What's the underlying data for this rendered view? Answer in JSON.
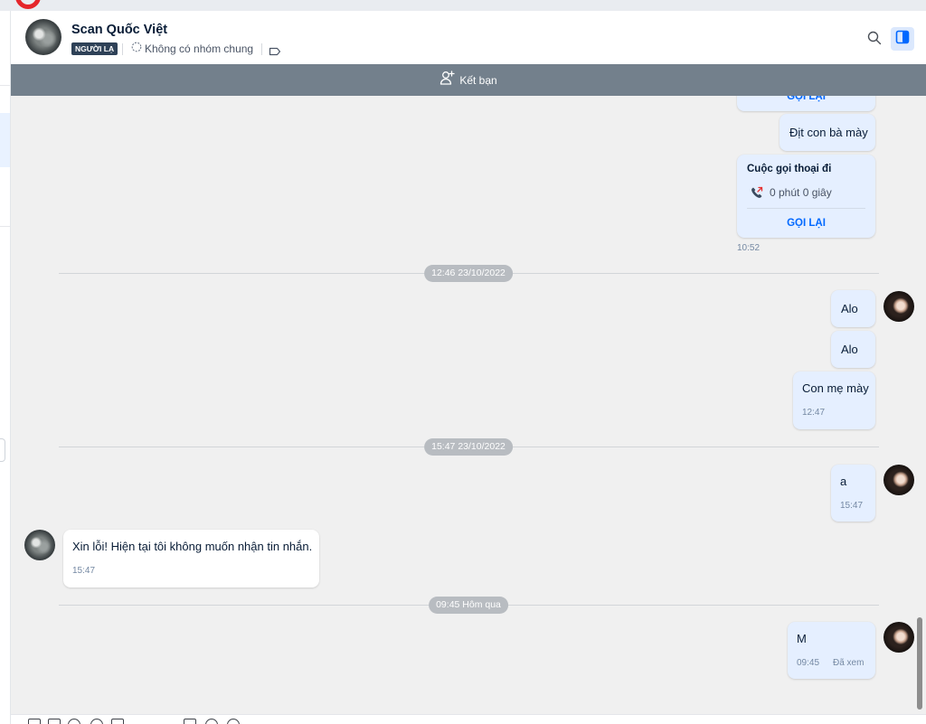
{
  "colors": {
    "accent": "#0068ff",
    "outgoing_bubble": "#e5efff",
    "incoming_bubble": "#ffffff",
    "friend_bar": "#73808c",
    "chat_background": "#f0f0f0",
    "stranger_badge": "#2e4157",
    "separator_pill": "#b8bcc1",
    "missed_call_arrow": "#e5302f",
    "brand_red": "#e5262b"
  },
  "icons": {
    "group": "group-dashed-circle-icon",
    "tag": "tag-icon",
    "search": "search-icon",
    "panel_toggle": "panel-toggle-icon",
    "add_friend": "add-user-icon",
    "outgoing_call": "outgoing-call-icon"
  },
  "header": {
    "contact_name": "Scan Quốc Việt",
    "stranger_badge": "NGƯỜI LẠ",
    "common_groups": "Không có nhóm chung"
  },
  "friend_bar": {
    "add_friend_label": "Kết bạn"
  },
  "conversation": {
    "partial_call": {
      "callback_label": "GỌI LẠI"
    },
    "sent_1": {
      "text": "Địt con bà mày"
    },
    "call_1": {
      "title": "Cuộc gọi thoại đi",
      "duration": "0 phút 0 giây",
      "callback_label": "GỌI LẠI",
      "time": "10:52"
    },
    "separator_1": {
      "label": "12:46 23/10/2022"
    },
    "sent_2": {
      "text": "Alo"
    },
    "sent_3": {
      "text": "Alo"
    },
    "sent_4": {
      "text": "Con mẹ mày",
      "time": "12:47"
    },
    "separator_2": {
      "label": "15:47 23/10/2022"
    },
    "sent_5": {
      "text": "a",
      "time": "15:47"
    },
    "received_1": {
      "text": "Xin lỗi! Hiện tại tôi không muốn nhận tin nhắn.",
      "time": "15:47"
    },
    "separator_3": {
      "label": "09:45 Hôm qua"
    },
    "sent_6": {
      "text": "M",
      "time": "09:45",
      "status": "Đã xem"
    }
  }
}
